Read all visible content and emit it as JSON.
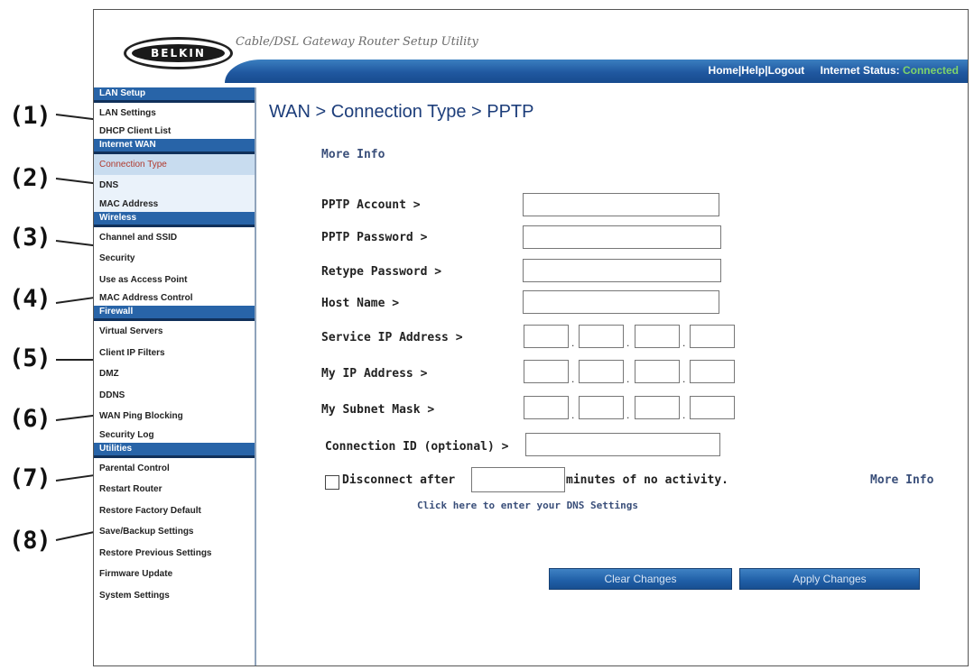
{
  "app": {
    "logo_text": "BELKIN",
    "title": "Cable/DSL Gateway Router Setup Utility"
  },
  "topnav": {
    "home": "Home",
    "help": "Help",
    "logout": "Logout",
    "status_label": "Internet Status:",
    "status_value": "Connected"
  },
  "callouts": [
    "(1)",
    "(2)",
    "(3)",
    "(4)",
    "(5)",
    "(6)",
    "(7)",
    "(8)"
  ],
  "sidebar": {
    "lan_setup": {
      "heading": "LAN Setup",
      "items": [
        "LAN Settings",
        "DHCP Client List"
      ]
    },
    "internet_wan": {
      "heading": "Internet WAN",
      "items": [
        "Connection Type",
        "DNS",
        "MAC Address"
      ]
    },
    "wireless": {
      "heading": "Wireless",
      "items": [
        "Channel and SSID",
        "Security",
        "Use as Access Point",
        "MAC Address Control"
      ]
    },
    "firewall": {
      "heading": "Firewall",
      "items": [
        "Virtual Servers",
        "Client IP Filters",
        "DMZ",
        "DDNS",
        "WAN Ping Blocking",
        "Security Log"
      ]
    },
    "utilities": {
      "heading": "Utilities",
      "items": [
        "Parental Control",
        "Restart Router",
        "Restore Factory Default",
        "Save/Backup Settings",
        "Restore Previous Settings",
        "Firmware Update",
        "System Settings"
      ]
    }
  },
  "main": {
    "title": "WAN > Connection Type > PPTP",
    "more_info": "More Info",
    "fields": {
      "pptp_account": {
        "label": "PPTP Account >",
        "value": ""
      },
      "pptp_password": {
        "label": "PPTP Password >",
        "value": ""
      },
      "retype_password": {
        "label": "Retype Password >",
        "value": ""
      },
      "host_name": {
        "label": "Host Name >",
        "value": ""
      },
      "service_ip": {
        "label": "Service IP Address >",
        "octets": [
          "",
          "",
          "",
          ""
        ]
      },
      "my_ip": {
        "label": "My IP Address >",
        "octets": [
          "",
          "",
          "",
          ""
        ]
      },
      "subnet_mask": {
        "label": "My Subnet Mask >",
        "octets": [
          "",
          "",
          "",
          ""
        ]
      },
      "connection_id": {
        "label": "Connection ID (optional) >",
        "value": ""
      }
    },
    "disconnect": {
      "checked": false,
      "label": "Disconnect after",
      "minutes_value": "",
      "suffix": "minutes of no activity.",
      "more_info": "More Info"
    },
    "dns_link": "Click here to enter your DNS Settings",
    "buttons": {
      "clear": "Clear Changes",
      "apply": "Apply Changes"
    }
  },
  "colors": {
    "nav_blue": "#2864a8",
    "title_blue": "#1c3d7a",
    "status_green": "#7fd36a",
    "active_item_red": "#b03a2e"
  }
}
